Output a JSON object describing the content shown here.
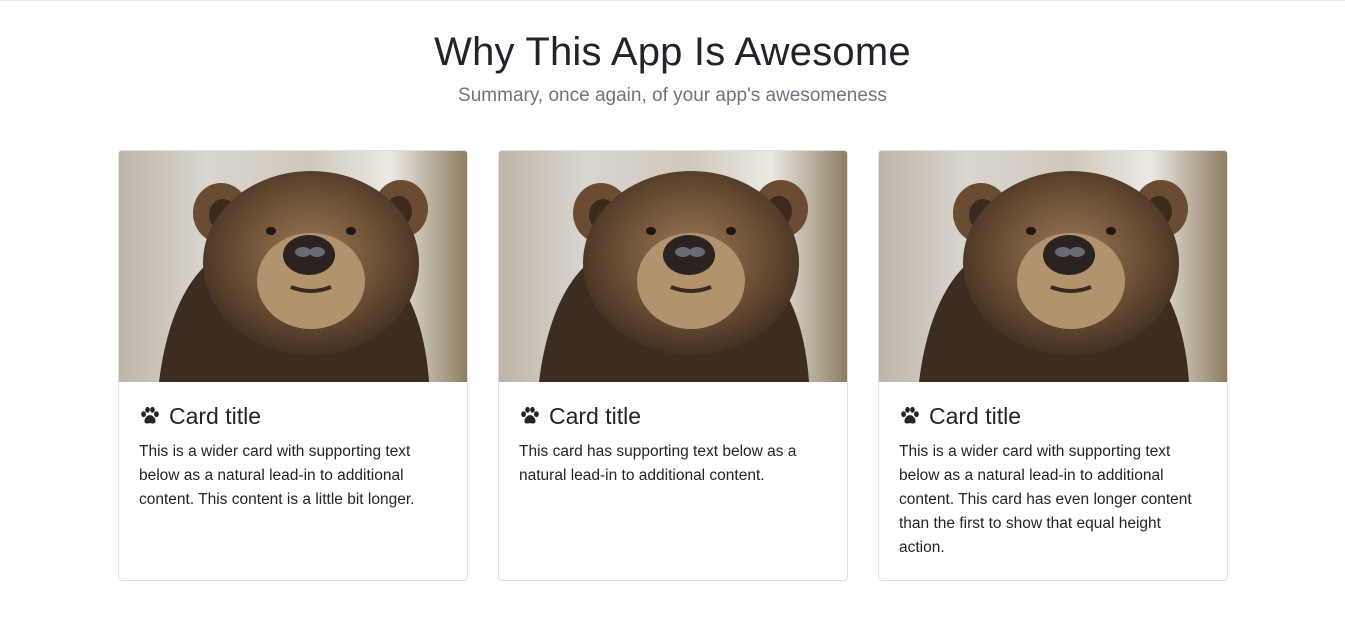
{
  "section": {
    "title": "Why This App Is Awesome",
    "subtitle": "Summary, once again, of your app's awesomeness"
  },
  "cards": [
    {
      "image_alt": "bear",
      "icon": "paw-icon",
      "title": "Card title",
      "text": "This is a wider card with supporting text below as a natural lead-in to additional content. This content is a little bit longer."
    },
    {
      "image_alt": "bear",
      "icon": "paw-icon",
      "title": "Card title",
      "text": "This card has supporting text below as a natural lead-in to additional content."
    },
    {
      "image_alt": "bear",
      "icon": "paw-icon",
      "title": "Card title",
      "text": "This is a wider card with supporting text below as a natural lead-in to additional content. This card has even longer content than the first to show that equal height action."
    }
  ],
  "colors": {
    "text": "#212529",
    "muted": "#6c757d",
    "border": "#dfdfdf"
  }
}
